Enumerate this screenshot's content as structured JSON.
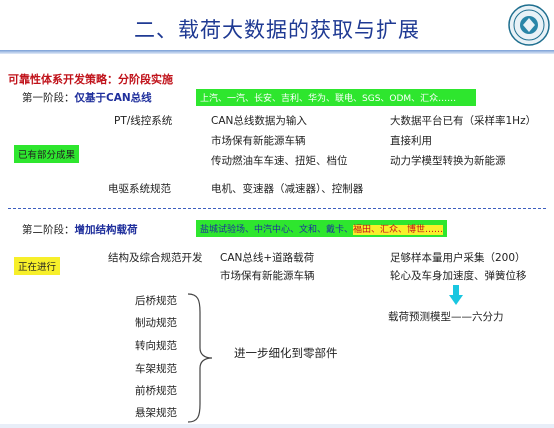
{
  "title": "二、载荷大数据的获取与扩展",
  "strategy_heading": "可靠性体系开发策略：分阶段实施",
  "stage1": {
    "label_prefix": "第一阶段：",
    "label_main": "仅基于CAN总线",
    "companies": "上汽、一汽、长安、吉利、华为、联电、SGS、ODM、汇众……",
    "status_badge": "已有部分成果",
    "rows": [
      {
        "left": "PT/线控系统",
        "mid": "CAN总线数据为输入",
        "right": "大数据平台已有（采样率1Hz）"
      },
      {
        "left": "",
        "mid": "市场保有新能源车辆",
        "right": "直接利用"
      },
      {
        "left": "",
        "mid": "传动燃油车车速、扭矩、档位",
        "right": "动力学模型转换为新能源"
      },
      {
        "left": "电驱系统规范",
        "mid": "电机、变速器（减速器）、控制器",
        "right": ""
      }
    ]
  },
  "stage2": {
    "label_prefix": "第二阶段：",
    "label_main": "增加结构载荷",
    "companies_blue": "盐城试验场、中汽中心、文和、戴卡、",
    "companies_red": "福田、汇众、博世……",
    "status_badge": "正在进行",
    "rows": [
      {
        "left": "结构及综合规范开发",
        "mid": "CAN总线+道路载荷",
        "right": "足够样本量用户采集（200）"
      },
      {
        "left": "",
        "mid": "市场保有新能源车辆",
        "right": "轮心及车身加速度、弹簧位移"
      }
    ],
    "model_result": "载荷预测模型——六分力",
    "specs": [
      "后桥规范",
      "制动规范",
      "转向规范",
      "车架规范",
      "前桥规范",
      "悬架规范"
    ],
    "brace_text": "进一步细化到零部件"
  },
  "colors": {
    "title": "#1f3a93",
    "heading_red": "#c0121a",
    "stage_blue": "#1f2f9c",
    "highlight_green": "#2ee62e",
    "highlight_yellow": "#f7ef2a",
    "arrow_cyan": "#19c6e0"
  },
  "icons": {
    "logo": "university-seal-icon",
    "arrow": "down-arrow-icon",
    "brace": "curly-brace-icon"
  }
}
